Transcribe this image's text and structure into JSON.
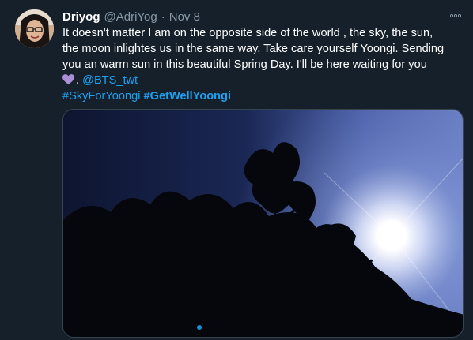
{
  "tweet": {
    "author_name": "Driyog",
    "author_handle": "@AdriYog",
    "separator": "·",
    "date": "Nov 8",
    "text_line_1": "It doesn't matter I am on the opposite side of the world , the sky, the sun,",
    "text_line_2": "the moon inlightes us in the same way. Take care yourself Yoongi. Sending",
    "text_line_3": "you an warm sun in this beautiful Spring Day. I'll be here waiting for you",
    "heart_emoji_name": "purple-heart-icon",
    "text_line_4_suffix": ".",
    "mention": "@BTS_twt",
    "hashtag_1": "#SkyForYoongi",
    "hashtag_2": "#GetWellYoongi"
  },
  "icons": {
    "more": "more-horizontal-icon",
    "heart": "purple-heart-icon"
  },
  "colors": {
    "background": "#15202b",
    "link": "#1da1f2",
    "secondary_text": "#8899a6",
    "heart": "#aa8ed6"
  }
}
